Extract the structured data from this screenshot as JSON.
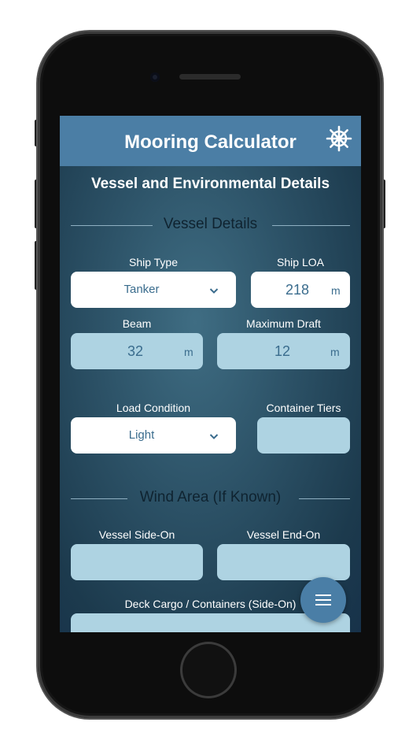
{
  "app": {
    "title": "Mooring Calculator",
    "section_title": "Vessel and Environmental Details",
    "header_color": "#4b7ea5",
    "settings_icon": "ship-wheel-icon"
  },
  "vessel_details": {
    "heading": "Vessel Details",
    "ship_type": {
      "label": "Ship Type",
      "value": "Tanker"
    },
    "ship_loa": {
      "label": "Ship LOA",
      "value": "218",
      "unit": "m"
    },
    "beam": {
      "label": "Beam",
      "value": "32",
      "unit": "m"
    },
    "max_draft": {
      "label": "Maximum Draft",
      "value": "12",
      "unit": "m"
    },
    "load_condition": {
      "label": "Load Condition",
      "value": "Light"
    },
    "container_tiers": {
      "label": "Container Tiers",
      "value": ""
    }
  },
  "wind_area": {
    "heading": "Wind Area (If Known)",
    "side_on": {
      "label": "Vessel Side-On",
      "value": ""
    },
    "end_on": {
      "label": "Vessel End-On",
      "value": ""
    },
    "deck_cargo": {
      "label": "Deck Cargo / Containers (Side-On)",
      "value": ""
    }
  },
  "fab": {
    "icon": "menu-icon"
  }
}
